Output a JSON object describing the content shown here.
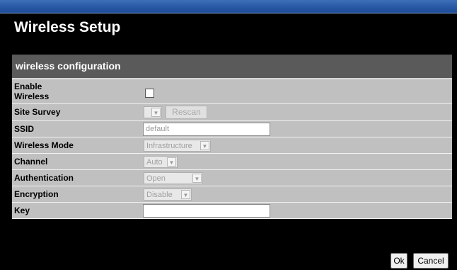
{
  "page": {
    "title": "Wireless Setup"
  },
  "section": {
    "header": "wireless configuration"
  },
  "rows": {
    "enable": {
      "label_line1": "Enable",
      "label_line2": "Wireless",
      "checked": false
    },
    "site_survey": {
      "label": "Site Survey",
      "select_value": "",
      "rescan_label": "Rescan"
    },
    "ssid": {
      "label": "SSID",
      "value": "default"
    },
    "mode": {
      "label": "Wireless Mode",
      "value": "Infrastructure"
    },
    "channel": {
      "label": "Channel",
      "value": "Auto"
    },
    "auth": {
      "label": "Authentication",
      "value": "Open"
    },
    "encryption": {
      "label": "Encryption",
      "value": "Disable"
    },
    "key": {
      "label": "Key",
      "value": ""
    }
  },
  "buttons": {
    "ok": "Ok",
    "cancel": "Cancel"
  },
  "colors": {
    "title_bar": "#2a5aa6",
    "background": "#000000",
    "section_header": "#5a5a5a",
    "row_bg": "#c0c0c0"
  },
  "icons": {
    "dropdown": "chevron-down-icon"
  }
}
